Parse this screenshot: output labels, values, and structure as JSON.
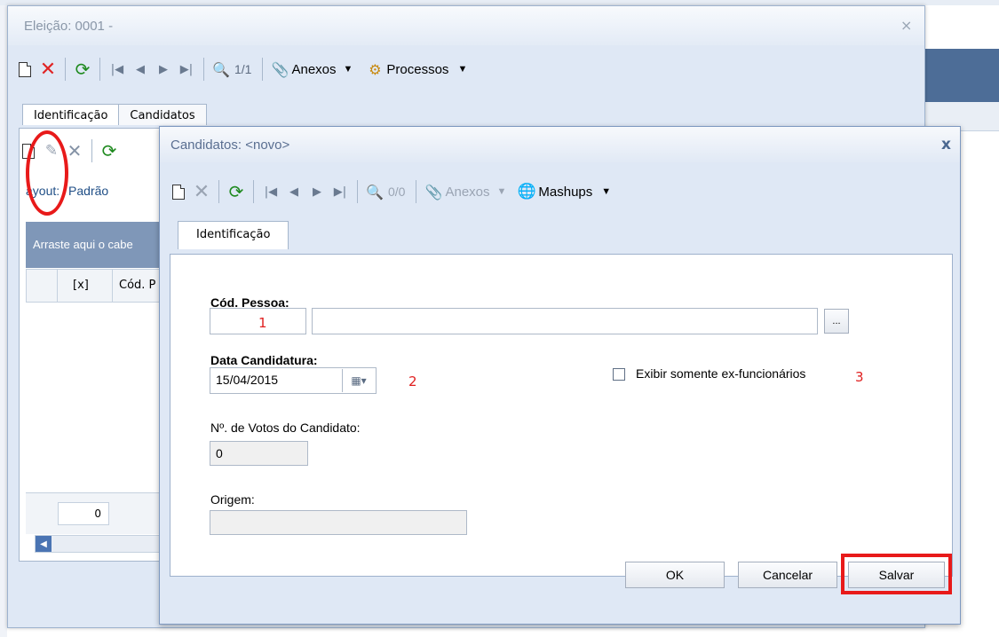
{
  "outer_window": {
    "title": "Eleição: 0001 -",
    "close_label": "×",
    "toolbar": {
      "record_counter": "1/1",
      "attachments_label": "Anexos",
      "processes_label": "Processos"
    },
    "tabs": [
      {
        "label": "Identificação"
      },
      {
        "label": "Candidatos"
      }
    ],
    "layout_label": "ayout:",
    "layout_value": "Padrão",
    "group_hint": "Arraste aqui o cabe",
    "columns": [
      "[x]",
      "Cód. P"
    ],
    "record_count": "0"
  },
  "dialog": {
    "title": "Candidatos: <novo>",
    "close_label": "x",
    "toolbar": {
      "record_counter": "0/0",
      "attachments_label": "Anexos",
      "mashups_label": "Mashups"
    },
    "tab_label": "Identificação",
    "form": {
      "cod_pessoa_label": "Cód. Pessoa:",
      "cod_pessoa_value": "",
      "nome_value": "",
      "lookup_label": "...",
      "data_label": "Data Candidatura:",
      "data_value": "15/04/2015",
      "checkbox_label": "Exibir somente ex-funcionários",
      "votos_label": "Nº. de Votos do Candidato:",
      "votos_value": "0",
      "origem_label": "Origem:",
      "origem_value": ""
    },
    "markers": {
      "one": "1",
      "two": "2",
      "three": "3"
    },
    "buttons": {
      "ok": "OK",
      "cancel": "Cancelar",
      "save": "Salvar"
    }
  },
  "highlight_color": "#e81a1a"
}
